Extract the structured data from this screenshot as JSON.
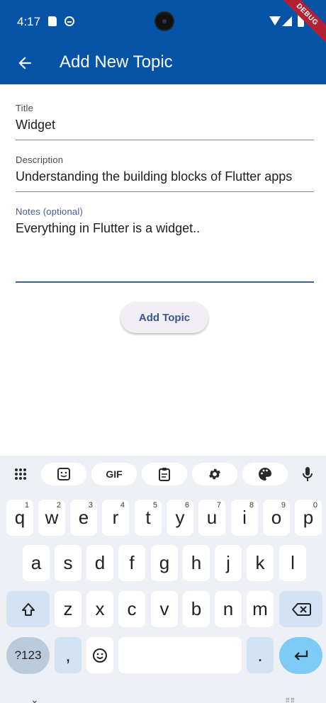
{
  "status_bar": {
    "time": "4:17",
    "debug_banner": "DEBUG"
  },
  "app_bar": {
    "title": "Add New Topic",
    "back_icon": "arrow-left-icon"
  },
  "form": {
    "title": {
      "label": "Title",
      "value": "Widget"
    },
    "description": {
      "label": "Description",
      "value": "Understanding the building blocks of Flutter apps"
    },
    "notes": {
      "label": "Notes (optional)",
      "value": "Everything in Flutter is a widget.."
    }
  },
  "add_button": {
    "label": "Add Topic"
  },
  "keyboard": {
    "toolbar": [
      "apps-grid-icon",
      "sticker-icon",
      "GIF",
      "clipboard-icon",
      "gear-icon",
      "palette-icon",
      "microphone-icon"
    ],
    "row1": [
      {
        "k": "q",
        "h": "1"
      },
      {
        "k": "w",
        "h": "2"
      },
      {
        "k": "e",
        "h": "3"
      },
      {
        "k": "r",
        "h": "4"
      },
      {
        "k": "t",
        "h": "5"
      },
      {
        "k": "y",
        "h": "6"
      },
      {
        "k": "u",
        "h": "7"
      },
      {
        "k": "i",
        "h": "8"
      },
      {
        "k": "o",
        "h": "9"
      },
      {
        "k": "p",
        "h": "0"
      }
    ],
    "row2": [
      "a",
      "s",
      "d",
      "f",
      "g",
      "h",
      "j",
      "k",
      "l"
    ],
    "row3": [
      "z",
      "x",
      "c",
      "v",
      "b",
      "n",
      "m"
    ],
    "symbols_label": "?123",
    "comma": ",",
    "period": ".",
    "colors": {
      "accent": "#7fcbf8",
      "function_key": "#d3e3f4",
      "symbols_key": "#bccbdb"
    }
  },
  "colors": {
    "app_bar": "#0553a6",
    "focused_field": "#3d5f98"
  }
}
